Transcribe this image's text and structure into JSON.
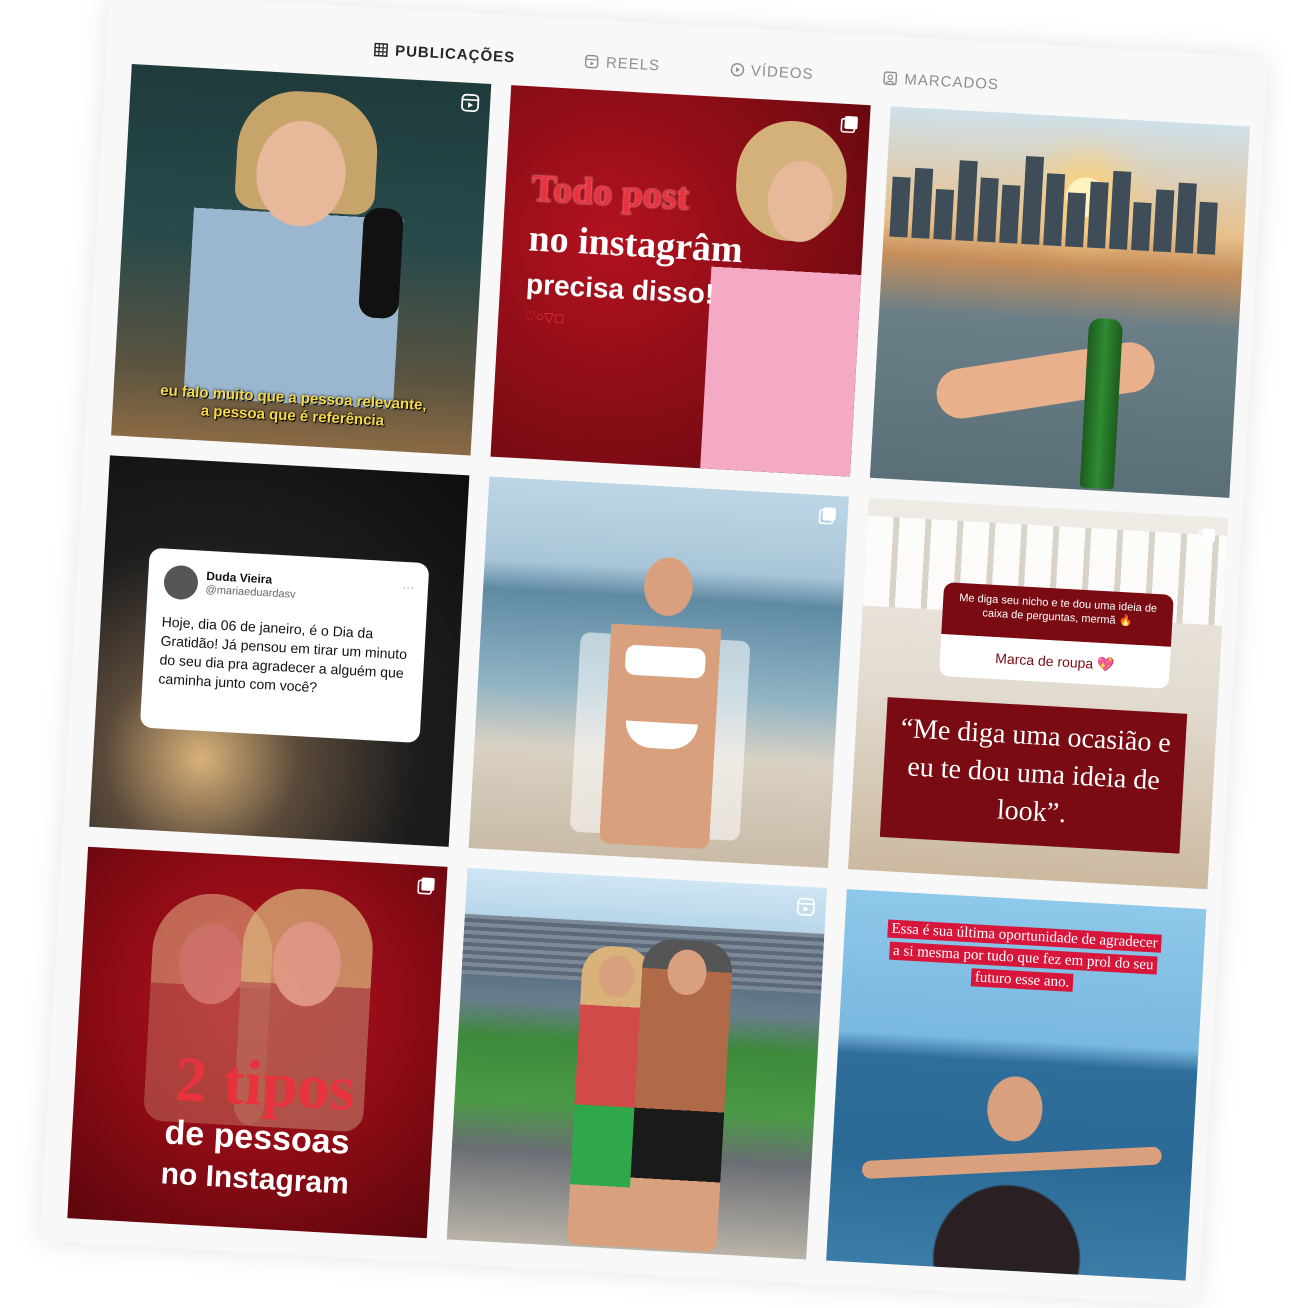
{
  "tabs": [
    {
      "label": "PUBLICAÇÕES",
      "icon": "grid-icon",
      "active": true
    },
    {
      "label": "REELS",
      "icon": "reels-icon",
      "active": false
    },
    {
      "label": "VÍDEOS",
      "icon": "play-icon",
      "active": false
    },
    {
      "label": "MARCADOS",
      "icon": "tag-icon",
      "active": false
    }
  ],
  "posts": {
    "p1": {
      "type": "reel",
      "caption_line1": "eu falo muito que a pessoa relevante,",
      "caption_line2": "a pessoa que é referência"
    },
    "p2": {
      "type": "carousel",
      "line1": "Todo post",
      "line2": "no instagrâm",
      "line3": "precisa disso!",
      "icons": "♡○▽◻"
    },
    "p3": {
      "type": "image"
    },
    "p4": {
      "type": "image",
      "tweet_name": "Duda Vieira",
      "tweet_handle": "@mariaeduardasv",
      "tweet_dots": "···",
      "tweet_text": "Hoje, dia 06 de janeiro, é o Dia da Gratidão! Já pensou em tirar um minuto do seu dia pra agradecer a alguém que caminha junto com você?"
    },
    "p5": {
      "type": "carousel"
    },
    "p6": {
      "type": "carousel",
      "question": "Me diga seu nicho e te dou uma ideia de caixa de perguntas, mermã 🔥",
      "answer": "Marca de roupa 💖",
      "quote": "“Me diga uma ocasião e eu te dou uma ideia de look”."
    },
    "p7": {
      "type": "carousel",
      "big": "2 tipos",
      "mid": "de pessoas",
      "bot": "no Instagram"
    },
    "p8": {
      "type": "reel"
    },
    "p9": {
      "type": "image",
      "caption": "Essa é sua última oportunidade de agradecer a si mesma por tudo que fez em prol do seu futuro esse ano."
    }
  }
}
